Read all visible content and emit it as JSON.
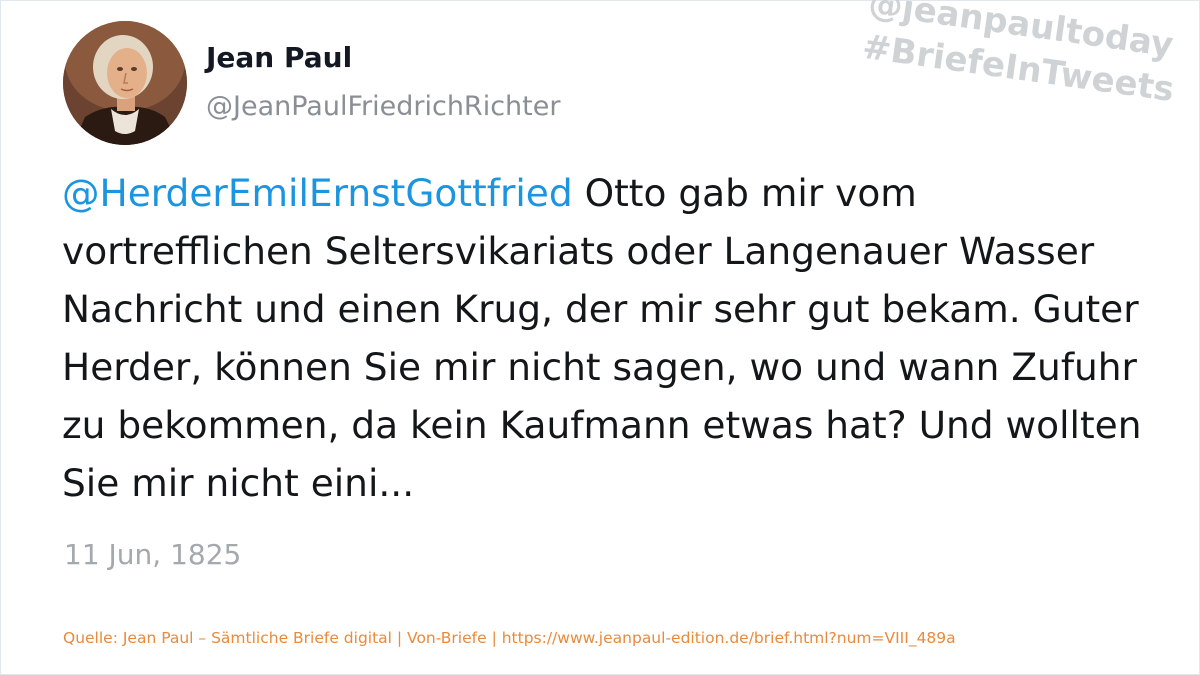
{
  "author": {
    "name": "Jean Paul",
    "handle": "@JeanPaulFriedrichRichter"
  },
  "watermark": {
    "line1": "@jeanpaultoday",
    "line2": "#BriefeInTweets"
  },
  "tweet": {
    "mention": "@HerderEmilErnstGottfried",
    "text": " Otto gab mir vom vortrefflichen Seltersvikariats oder Langenauer Wasser Nachricht und einen Krug, der mir sehr gut bekam. Guter Herder, können Sie mir nicht sagen, wo und wann Zufuhr zu bekommen, da kein Kaufmann etwas hat? Und wollten Sie mir nicht eini...",
    "date": "11 Jun, 1825"
  },
  "source": {
    "text": "Quelle: Jean Paul – Sämtliche Briefe digital | Von-Briefe | https://www.jeanpaul-edition.de/brief.html?num=VIII_489a"
  },
  "colors": {
    "mention": "#1b95e0",
    "text": "#14171a",
    "handle": "#8a8f95",
    "date": "#a4a9ae",
    "source": "#e98a3c",
    "watermark": "#cfd3d6"
  }
}
